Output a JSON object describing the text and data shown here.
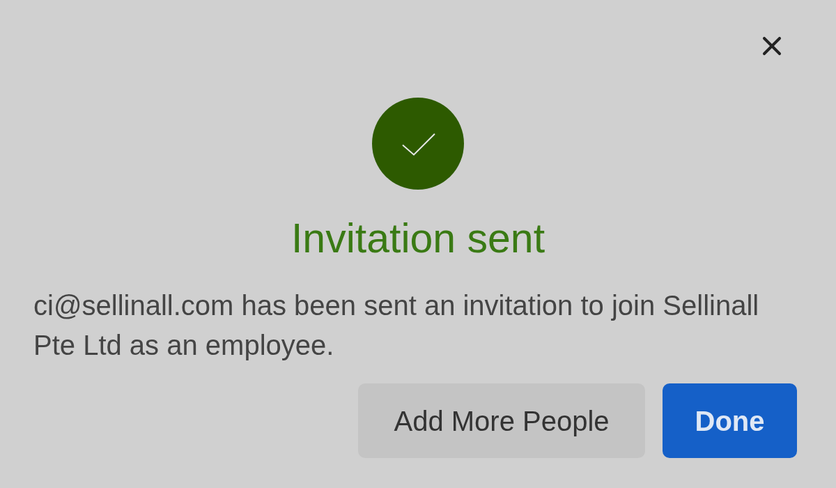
{
  "dialog": {
    "title": "Invitation sent",
    "message": "ci@sellinall.com has been sent an invitation to join Sellinall Pte Ltd as an employee.",
    "buttons": [
      {
        "label": "Add More People",
        "kind": "secondary"
      },
      {
        "label": "Done",
        "kind": "primary"
      }
    ]
  }
}
